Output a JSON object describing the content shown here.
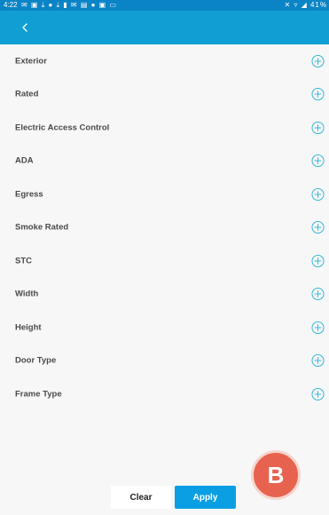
{
  "status_bar": {
    "time": "4:22",
    "notification_icons": "✉ ▣ ⤓ ● ⤓ ▮ ✉ ▤ ● ▣ ▭",
    "right_icons": "✕ ▿ ◢ 41%"
  },
  "app_bar": {
    "back_icon": "chevron-left-icon"
  },
  "filters": [
    {
      "label": "Exterior"
    },
    {
      "label": "Rated"
    },
    {
      "label": "Electric Access Control"
    },
    {
      "label": "ADA"
    },
    {
      "label": "Egress"
    },
    {
      "label": "Smoke Rated"
    },
    {
      "label": "STC"
    },
    {
      "label": "Width"
    },
    {
      "label": "Height"
    },
    {
      "label": "Door Type"
    },
    {
      "label": "Frame Type"
    }
  ],
  "footer": {
    "clear_label": "Clear",
    "apply_label": "Apply"
  },
  "marker_label": "B",
  "colors": {
    "app_bar": "#119fd3",
    "status_bar": "#0a84c6",
    "accent": "#2bb5d8",
    "apply_button": "#0a9fe3",
    "marker": "#e8634f"
  }
}
